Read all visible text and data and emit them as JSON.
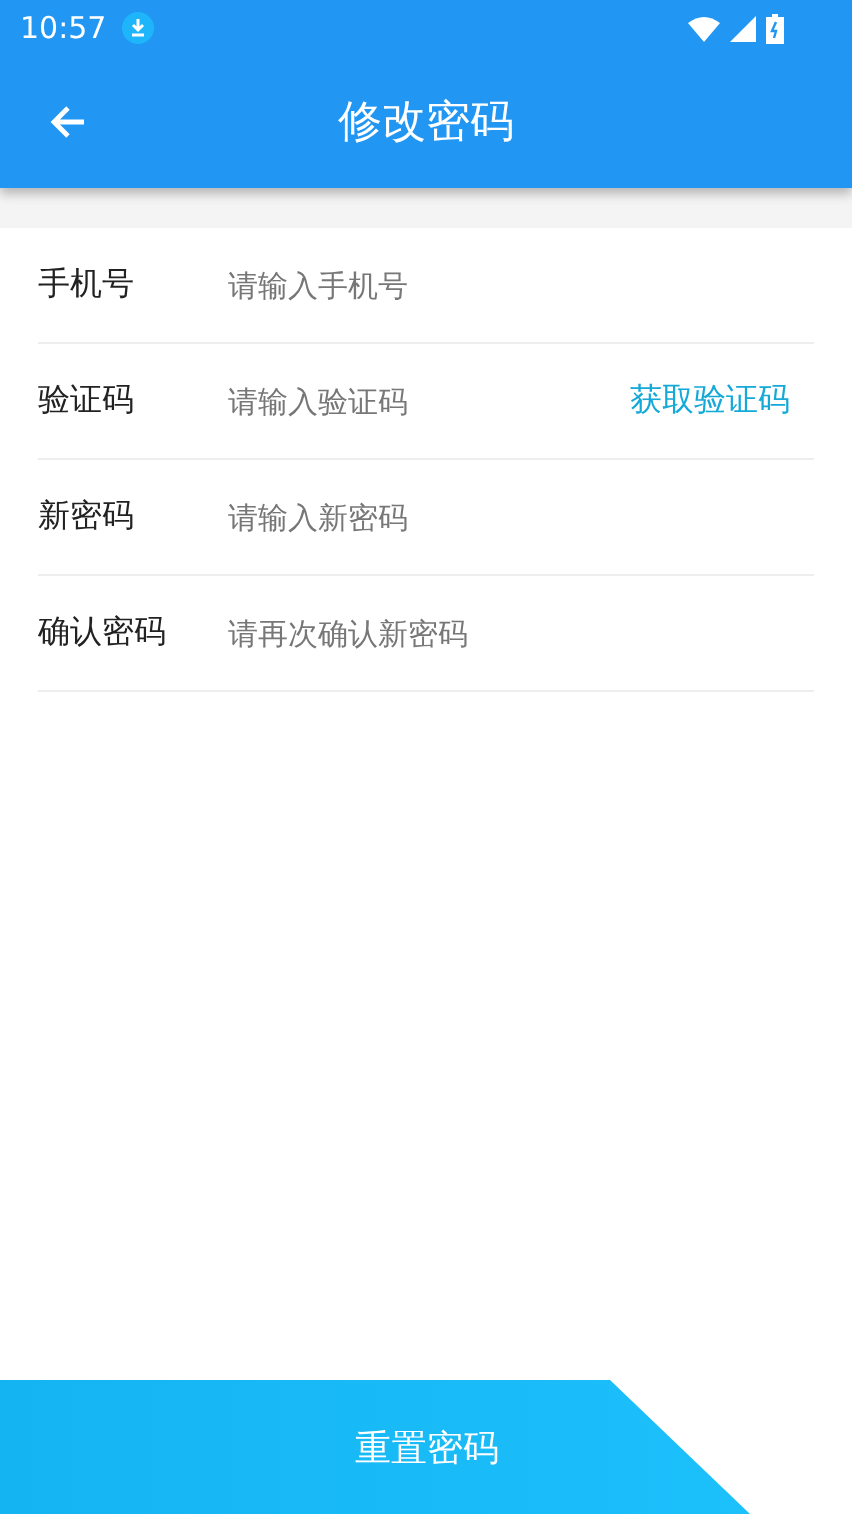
{
  "status_bar": {
    "time": "10:57"
  },
  "app_bar": {
    "title": "修改密码"
  },
  "fields": [
    {
      "kind": "text",
      "label": "手机号",
      "placeholder": "请输入手机号"
    },
    {
      "kind": "code",
      "label": "验证码",
      "placeholder": "请输入验证码",
      "action": "获取验证码"
    },
    {
      "kind": "password",
      "label": "新密码",
      "placeholder": "请输入新密码"
    },
    {
      "kind": "password",
      "label": "确认密码",
      "placeholder": "请再次确认新密码"
    }
  ],
  "submit_button": "重置密码"
}
